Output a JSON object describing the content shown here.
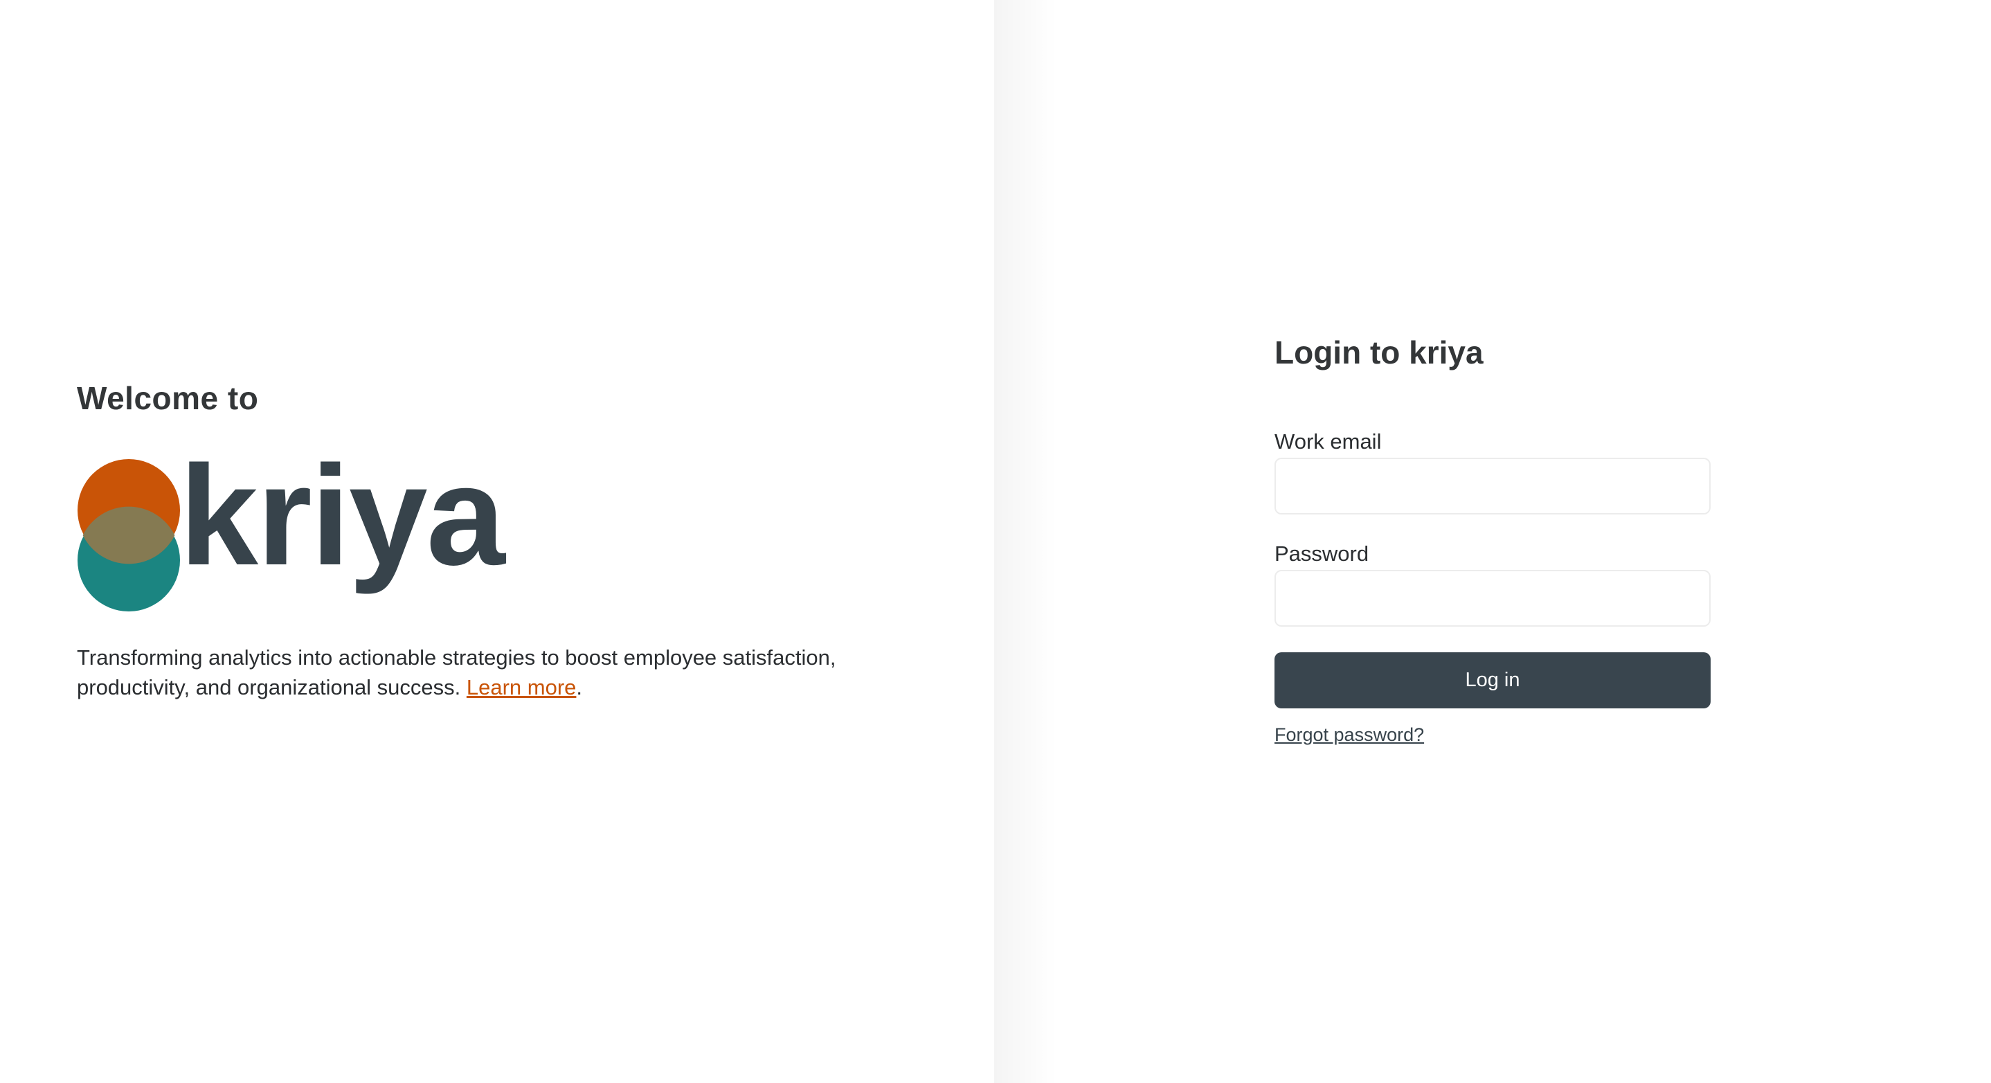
{
  "welcome": {
    "heading": "Welcome to",
    "brand_name": "kriya",
    "tagline": "Transforming analytics into actionable strategies to boost employee satisfaction, productivity, and organizational success. ",
    "learn_more": "Learn more",
    "tagline_end": "."
  },
  "login": {
    "title": "Login to kriya",
    "email_label": "Work email",
    "email_value": "",
    "email_placeholder": "",
    "password_label": "Password",
    "password_value": "",
    "password_placeholder": "",
    "submit_label": "Log in",
    "forgot_label": "Forgot password?"
  },
  "colors": {
    "accent_orange": "#c95407",
    "accent_teal": "#1b8581",
    "overlap": "#857a52",
    "brand_dark": "#37434b",
    "button_bg": "#39454e"
  }
}
